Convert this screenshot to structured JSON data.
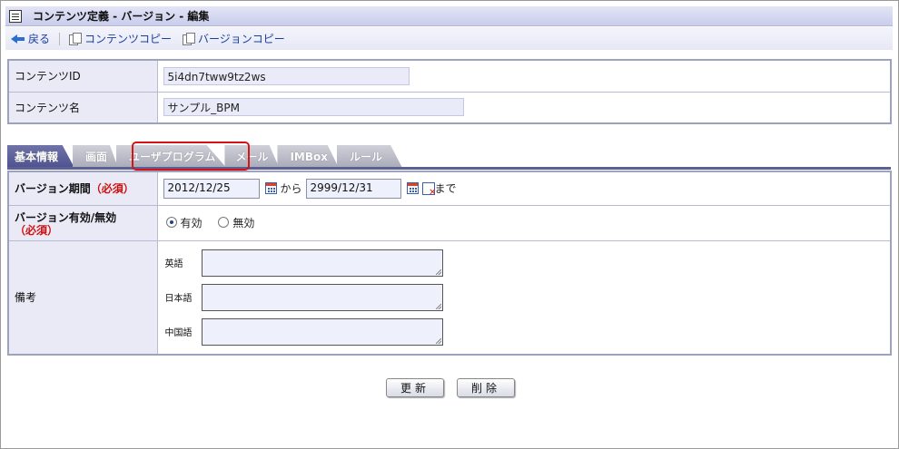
{
  "window": {
    "title": "コンテンツ定義 - バージョン - 編集"
  },
  "toolbar": {
    "back": "戻る",
    "content_copy": "コンテンツコピー",
    "version_copy": "バージョンコピー"
  },
  "content": {
    "id_label": "コンテンツID",
    "id_value": "5i4dn7tww9tz2ws",
    "name_label": "コンテンツ名",
    "name_value": "サンプル_BPM"
  },
  "tabs": [
    "基本情報",
    "画面",
    "ユーザプログラム",
    "メール",
    "IMBox",
    "ルール"
  ],
  "active_tab": "基本情報",
  "highlighted_tab": "ユーザプログラム",
  "version": {
    "period_label": "バージョン期間",
    "required": "（必須）",
    "start_date": "2012/12/25",
    "from": "から",
    "end_date": "2999/12/31",
    "until": "まで",
    "enabled_label": "バージョン有効/無効",
    "enabled_option": "有効",
    "disabled_option": "無効",
    "selected": "有効",
    "notes_label": "備考",
    "lang_en": "英語",
    "lang_ja": "日本語",
    "lang_zh": "中国語"
  },
  "buttons": {
    "update": "更新",
    "delete": "削除"
  },
  "colors": {
    "accent": "#5b5f96",
    "highlight": "#d41515",
    "required": "#d01010",
    "label_bg": "#e9eaf6"
  }
}
